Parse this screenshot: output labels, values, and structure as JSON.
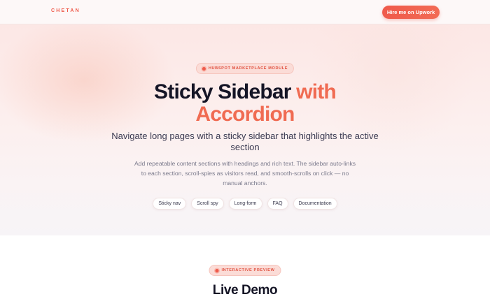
{
  "nav": {
    "brand": "CHETAN",
    "cta_label": "Hire me on Upwork"
  },
  "hero": {
    "badge": "HUBSPOT MARKETPLACE MODULE",
    "title_plain": "Sticky Sidebar ",
    "title_accent_1": "with",
    "title_accent_2": "Accordion",
    "subtitle": "Navigate long pages with a sticky sidebar that highlights the active section",
    "description": "Add repeatable content sections with headings and rich text. The sidebar auto-links to each section, scroll-spies as visitors read, and smooth-scrolls on click — no manual anchors.",
    "tags": [
      "Sticky nav",
      "Scroll spy",
      "Long-form",
      "FAQ",
      "Documentation"
    ]
  },
  "demo": {
    "badge": "INTERACTIVE PREVIEW",
    "title": "Live Demo"
  },
  "colors": {
    "accent": "#ef5a4b",
    "accent_light": "#f06b52",
    "heading": "#151526"
  }
}
